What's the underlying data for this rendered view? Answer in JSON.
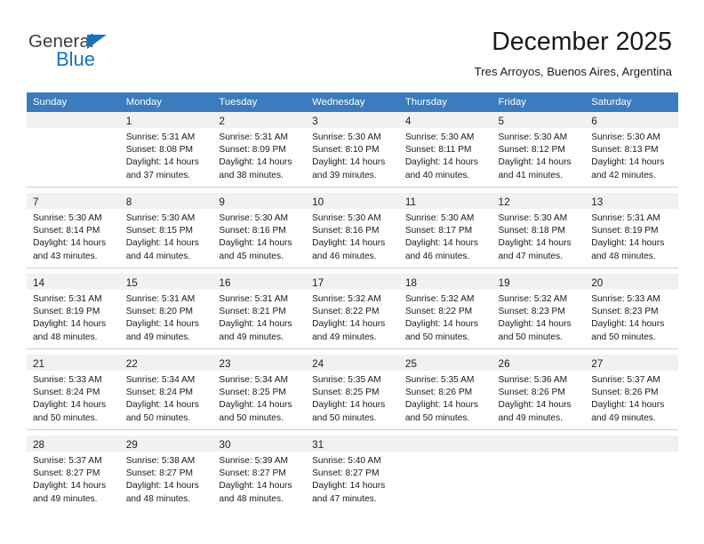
{
  "logo": {
    "word_dark": "General",
    "word_blue": "Blue",
    "triangle_color": "#1273b8",
    "dark_color": "#3c3c3c"
  },
  "header": {
    "title": "December 2025",
    "subtitle": "Tres Arroyos, Buenos Aires, Argentina",
    "header_bg": "#3a7cbd",
    "daynum_bg": "#f1f1f1"
  },
  "weekday_headers": [
    "Sunday",
    "Monday",
    "Tuesday",
    "Wednesday",
    "Thursday",
    "Friday",
    "Saturday"
  ],
  "weeks": [
    [
      {
        "day": "",
        "lines": []
      },
      {
        "day": "1",
        "lines": [
          "Sunrise: 5:31 AM",
          "Sunset: 8:08 PM",
          "Daylight: 14 hours",
          "and 37 minutes."
        ]
      },
      {
        "day": "2",
        "lines": [
          "Sunrise: 5:31 AM",
          "Sunset: 8:09 PM",
          "Daylight: 14 hours",
          "and 38 minutes."
        ]
      },
      {
        "day": "3",
        "lines": [
          "Sunrise: 5:30 AM",
          "Sunset: 8:10 PM",
          "Daylight: 14 hours",
          "and 39 minutes."
        ]
      },
      {
        "day": "4",
        "lines": [
          "Sunrise: 5:30 AM",
          "Sunset: 8:11 PM",
          "Daylight: 14 hours",
          "and 40 minutes."
        ]
      },
      {
        "day": "5",
        "lines": [
          "Sunrise: 5:30 AM",
          "Sunset: 8:12 PM",
          "Daylight: 14 hours",
          "and 41 minutes."
        ]
      },
      {
        "day": "6",
        "lines": [
          "Sunrise: 5:30 AM",
          "Sunset: 8:13 PM",
          "Daylight: 14 hours",
          "and 42 minutes."
        ]
      }
    ],
    [
      {
        "day": "7",
        "lines": [
          "Sunrise: 5:30 AM",
          "Sunset: 8:14 PM",
          "Daylight: 14 hours",
          "and 43 minutes."
        ]
      },
      {
        "day": "8",
        "lines": [
          "Sunrise: 5:30 AM",
          "Sunset: 8:15 PM",
          "Daylight: 14 hours",
          "and 44 minutes."
        ]
      },
      {
        "day": "9",
        "lines": [
          "Sunrise: 5:30 AM",
          "Sunset: 8:16 PM",
          "Daylight: 14 hours",
          "and 45 minutes."
        ]
      },
      {
        "day": "10",
        "lines": [
          "Sunrise: 5:30 AM",
          "Sunset: 8:16 PM",
          "Daylight: 14 hours",
          "and 46 minutes."
        ]
      },
      {
        "day": "11",
        "lines": [
          "Sunrise: 5:30 AM",
          "Sunset: 8:17 PM",
          "Daylight: 14 hours",
          "and 46 minutes."
        ]
      },
      {
        "day": "12",
        "lines": [
          "Sunrise: 5:30 AM",
          "Sunset: 8:18 PM",
          "Daylight: 14 hours",
          "and 47 minutes."
        ]
      },
      {
        "day": "13",
        "lines": [
          "Sunrise: 5:31 AM",
          "Sunset: 8:19 PM",
          "Daylight: 14 hours",
          "and 48 minutes."
        ]
      }
    ],
    [
      {
        "day": "14",
        "lines": [
          "Sunrise: 5:31 AM",
          "Sunset: 8:19 PM",
          "Daylight: 14 hours",
          "and 48 minutes."
        ]
      },
      {
        "day": "15",
        "lines": [
          "Sunrise: 5:31 AM",
          "Sunset: 8:20 PM",
          "Daylight: 14 hours",
          "and 49 minutes."
        ]
      },
      {
        "day": "16",
        "lines": [
          "Sunrise: 5:31 AM",
          "Sunset: 8:21 PM",
          "Daylight: 14 hours",
          "and 49 minutes."
        ]
      },
      {
        "day": "17",
        "lines": [
          "Sunrise: 5:32 AM",
          "Sunset: 8:22 PM",
          "Daylight: 14 hours",
          "and 49 minutes."
        ]
      },
      {
        "day": "18",
        "lines": [
          "Sunrise: 5:32 AM",
          "Sunset: 8:22 PM",
          "Daylight: 14 hours",
          "and 50 minutes."
        ]
      },
      {
        "day": "19",
        "lines": [
          "Sunrise: 5:32 AM",
          "Sunset: 8:23 PM",
          "Daylight: 14 hours",
          "and 50 minutes."
        ]
      },
      {
        "day": "20",
        "lines": [
          "Sunrise: 5:33 AM",
          "Sunset: 8:23 PM",
          "Daylight: 14 hours",
          "and 50 minutes."
        ]
      }
    ],
    [
      {
        "day": "21",
        "lines": [
          "Sunrise: 5:33 AM",
          "Sunset: 8:24 PM",
          "Daylight: 14 hours",
          "and 50 minutes."
        ]
      },
      {
        "day": "22",
        "lines": [
          "Sunrise: 5:34 AM",
          "Sunset: 8:24 PM",
          "Daylight: 14 hours",
          "and 50 minutes."
        ]
      },
      {
        "day": "23",
        "lines": [
          "Sunrise: 5:34 AM",
          "Sunset: 8:25 PM",
          "Daylight: 14 hours",
          "and 50 minutes."
        ]
      },
      {
        "day": "24",
        "lines": [
          "Sunrise: 5:35 AM",
          "Sunset: 8:25 PM",
          "Daylight: 14 hours",
          "and 50 minutes."
        ]
      },
      {
        "day": "25",
        "lines": [
          "Sunrise: 5:35 AM",
          "Sunset: 8:26 PM",
          "Daylight: 14 hours",
          "and 50 minutes."
        ]
      },
      {
        "day": "26",
        "lines": [
          "Sunrise: 5:36 AM",
          "Sunset: 8:26 PM",
          "Daylight: 14 hours",
          "and 49 minutes."
        ]
      },
      {
        "day": "27",
        "lines": [
          "Sunrise: 5:37 AM",
          "Sunset: 8:26 PM",
          "Daylight: 14 hours",
          "and 49 minutes."
        ]
      }
    ],
    [
      {
        "day": "28",
        "lines": [
          "Sunrise: 5:37 AM",
          "Sunset: 8:27 PM",
          "Daylight: 14 hours",
          "and 49 minutes."
        ]
      },
      {
        "day": "29",
        "lines": [
          "Sunrise: 5:38 AM",
          "Sunset: 8:27 PM",
          "Daylight: 14 hours",
          "and 48 minutes."
        ]
      },
      {
        "day": "30",
        "lines": [
          "Sunrise: 5:39 AM",
          "Sunset: 8:27 PM",
          "Daylight: 14 hours",
          "and 48 minutes."
        ]
      },
      {
        "day": "31",
        "lines": [
          "Sunrise: 5:40 AM",
          "Sunset: 8:27 PM",
          "Daylight: 14 hours",
          "and 47 minutes."
        ]
      },
      {
        "day": "",
        "lines": []
      },
      {
        "day": "",
        "lines": []
      },
      {
        "day": "",
        "lines": []
      }
    ]
  ]
}
